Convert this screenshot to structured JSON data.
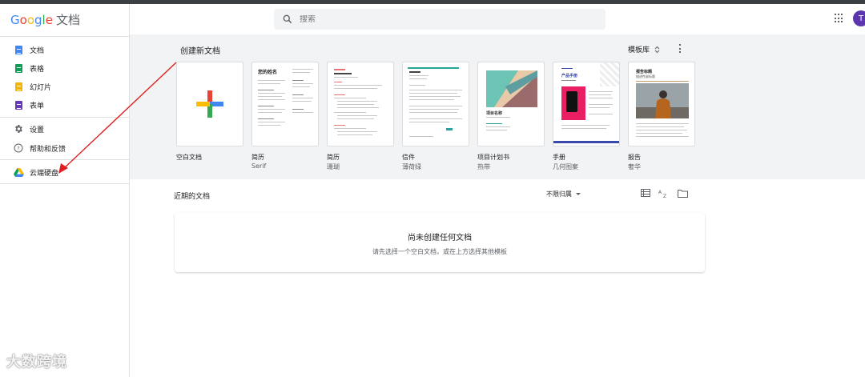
{
  "app": {
    "logo_brand": "Google",
    "logo_product": "文档"
  },
  "sidebar": {
    "items": [
      {
        "label": "文档",
        "icon": "docs-icon",
        "color": "#4285f4"
      },
      {
        "label": "表格",
        "icon": "sheets-icon",
        "color": "#0f9d58"
      },
      {
        "label": "幻灯片",
        "icon": "slides-icon",
        "color": "#f4b400"
      },
      {
        "label": "表单",
        "icon": "forms-icon",
        "color": "#673ab7"
      },
      {
        "label": "设置",
        "icon": "gear-icon"
      },
      {
        "label": "帮助和反馈",
        "icon": "help-icon"
      },
      {
        "label": "云端硬盘",
        "icon": "drive-icon"
      }
    ]
  },
  "search": {
    "placeholder": "搜索"
  },
  "account": {
    "avatar_letter": "T",
    "avatar_color": "#5e35b1"
  },
  "gallery": {
    "title": "创建新文档",
    "template_gallery_label": "模板库",
    "templates": [
      {
        "name": "空白文档",
        "sub": ""
      },
      {
        "name": "简历",
        "sub": "Serif"
      },
      {
        "name": "简历",
        "sub": "珊瑚"
      },
      {
        "name": "信件",
        "sub": "薄荷绿"
      },
      {
        "name": "项目计划书",
        "sub": "热带"
      },
      {
        "name": "手册",
        "sub": "几何图案"
      },
      {
        "name": "报告",
        "sub": "奢华"
      }
    ],
    "thumb_text": {
      "resume_name": "您的姓名",
      "project_title": "项目名称",
      "brochure_title": "产品手册",
      "report_title": "报告标题",
      "report_subtitle": "描述性副标题"
    }
  },
  "recent": {
    "title": "近期的文档",
    "owner_filter": "不限归属",
    "empty_heading": "尚未创建任何文档",
    "empty_hint": "请先选择一个空白文档，或在上方选择其他模板"
  },
  "watermark": "大数跨境"
}
